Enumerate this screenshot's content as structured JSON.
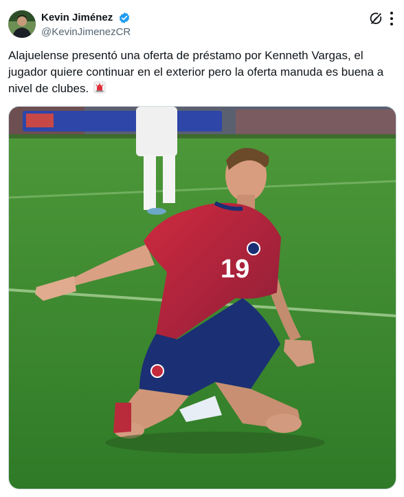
{
  "author": {
    "display_name": "Kevin Jiménez",
    "handle": "@KevinJimenezCR",
    "verified": true,
    "avatar_icon": "profile-photo"
  },
  "tweet": {
    "text": "Alajuelense presentó una oferta de préstamo por Kenneth Vargas, el jugador quiere continuar en el exterior pero la oferta manuda es buena a nivel de clubes.",
    "emoji": "police-light-emoji"
  },
  "media": {
    "jersey_number": "19",
    "description_icon": "soccer-player-photo"
  },
  "colors": {
    "text": "#0f1419",
    "secondary": "#536471",
    "verified": "#1d9bf0",
    "pitch": "#3f8a2e",
    "jersey_red": "#b8203a",
    "shorts_navy": "#1b2f74"
  },
  "icons": [
    "verified-badge-icon",
    "grok-icon",
    "more-icon"
  ]
}
